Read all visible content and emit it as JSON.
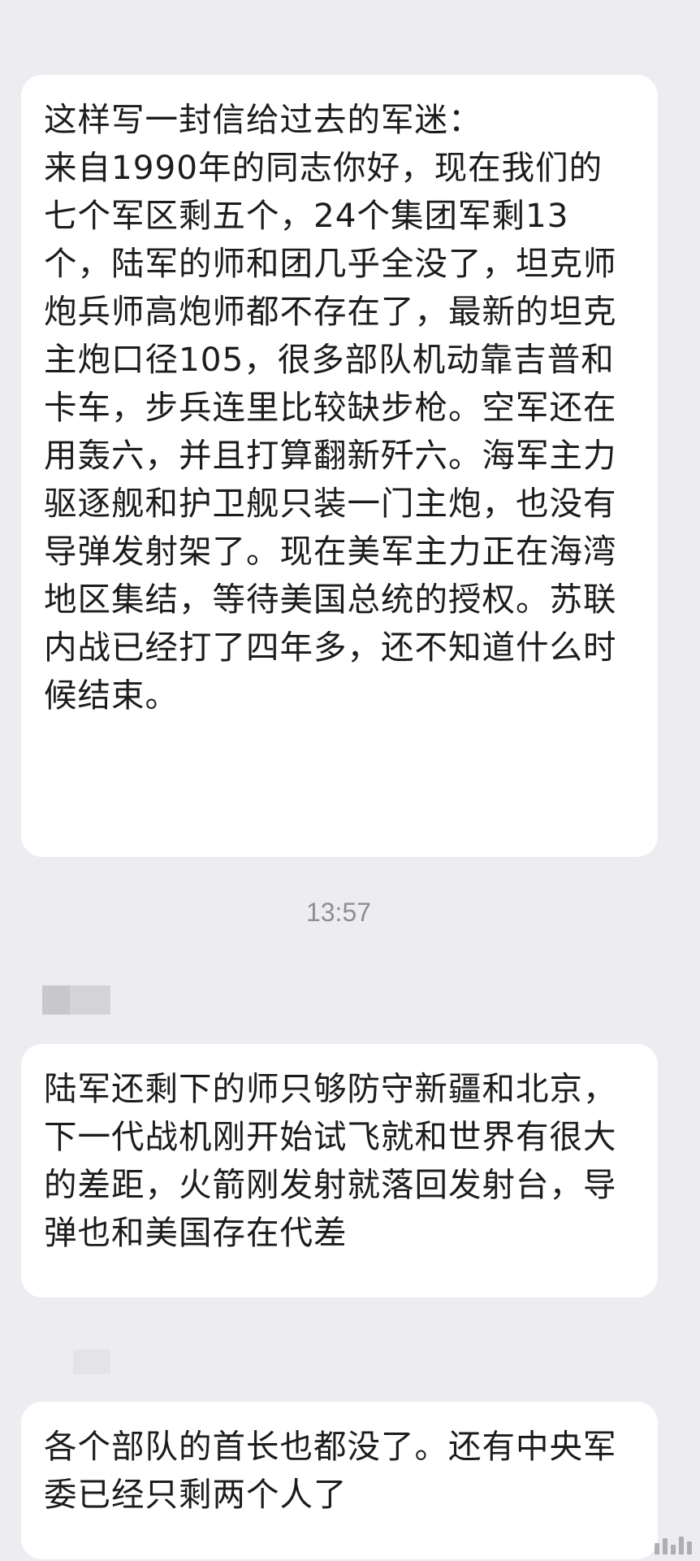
{
  "messages": [
    {
      "text": "这样写一封信给过去的军迷：\n来自1990年的同志你好，现在我们的七个军区剩五个，24个集团军剩13个，陆军的师和团几乎全没了，坦克师炮兵师高炮师都不存在了，最新的坦克主炮口径105，很多部队机动靠吉普和卡车，步兵连里比较缺步枪。空军还在用轰六，并且打算翻新歼六。海军主力驱逐舰和护卫舰只装一门主炮，也没有导弹发射架了。现在美军主力正在海湾地区集结，等待美国总统的授权。苏联内战已经打了四年多，还不知道什么时候结束。"
    },
    {
      "text": "陆军还剩下的师只够防守新疆和北京，下一代战机刚开始试飞就和世界有很大的差距，火箭刚发射就落回发射台，导弹也和美国存在代差"
    },
    {
      "text": "各个部队的首长也都没了。还有中央军委已经只剩两个人了"
    }
  ],
  "timestamp": "13:57",
  "colors": {
    "background": "#ececf1",
    "bubble": "#ffffff",
    "text": "#1c1c1e",
    "timestamp": "#8e8e93"
  }
}
